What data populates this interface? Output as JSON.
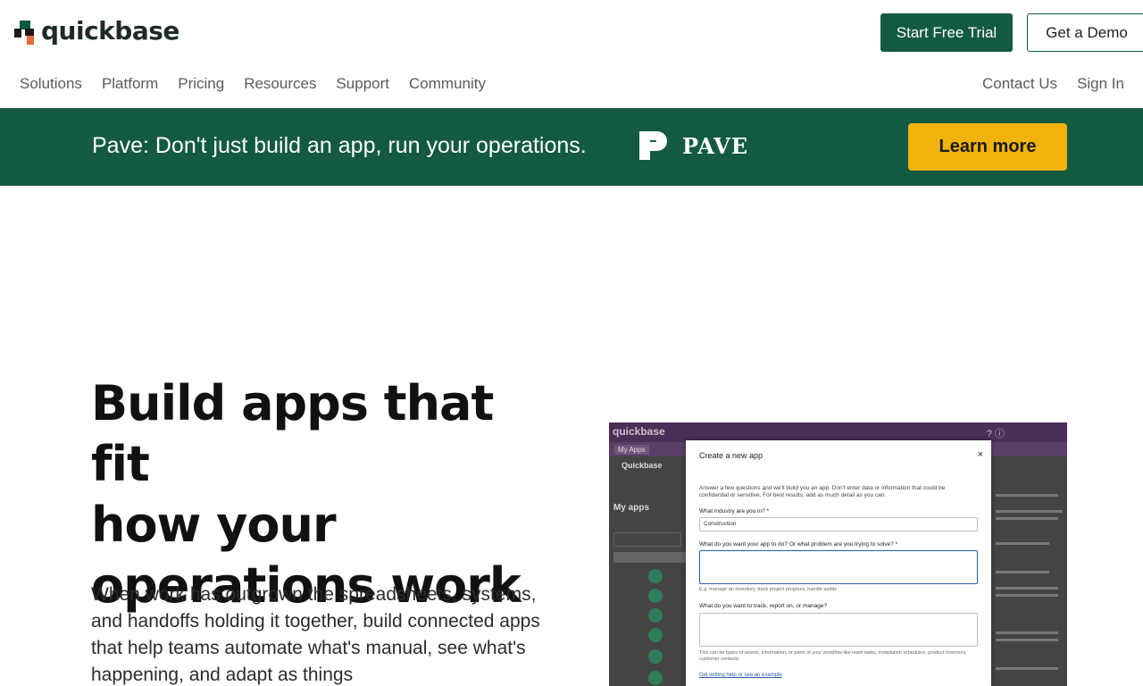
{
  "header": {
    "logo_text": "quickbase",
    "trial_button": "Start Free Trial",
    "demo_button": "Get a Demo",
    "nav": [
      "Solutions",
      "Platform",
      "Pricing",
      "Resources",
      "Support",
      "Community"
    ],
    "nav_right": [
      "Contact Us",
      "Sign In"
    ]
  },
  "banner": {
    "text": "Pave: Don't just build an app, run your operations.",
    "brand": "PAVE",
    "button": "Learn more"
  },
  "hero": {
    "title_lines": [
      "Build apps that fit",
      "how your",
      "operations work"
    ],
    "body": "When work has outgrown the spreadsheets, systems, and handoffs holding it together, build connected apps that help teams automate what's manual, see what's happening, and adapt as things"
  },
  "mock": {
    "brand": "quickbase",
    "tab": "My Apps",
    "side_title": "Quickbase",
    "side_myapps": "My apps",
    "modal": {
      "title": "Create a new app",
      "close": "×",
      "intro": "Answer a few questions and we'll build you an app. Don't enter data or information that could be confidential or sensitive. For best results, add as much detail as you can.",
      "q1": "What industry are you in? *",
      "q1_value": "Construction",
      "q2": "What do you want your app to do? Or what problem are you trying to solve? *",
      "q2_help": "E.g. manage an inventory, track project progress, handle audits",
      "q3": "What do you want to track, report on, or manage?",
      "q3_help": "This can be types of assets, information, or parts of your workflow like team tasks, installation schedules, product inventory, customer contacts",
      "link": "Get writing help or see an example"
    }
  },
  "colors": {
    "brand_green": "#135a40",
    "accent_yellow": "#f1b20c"
  }
}
